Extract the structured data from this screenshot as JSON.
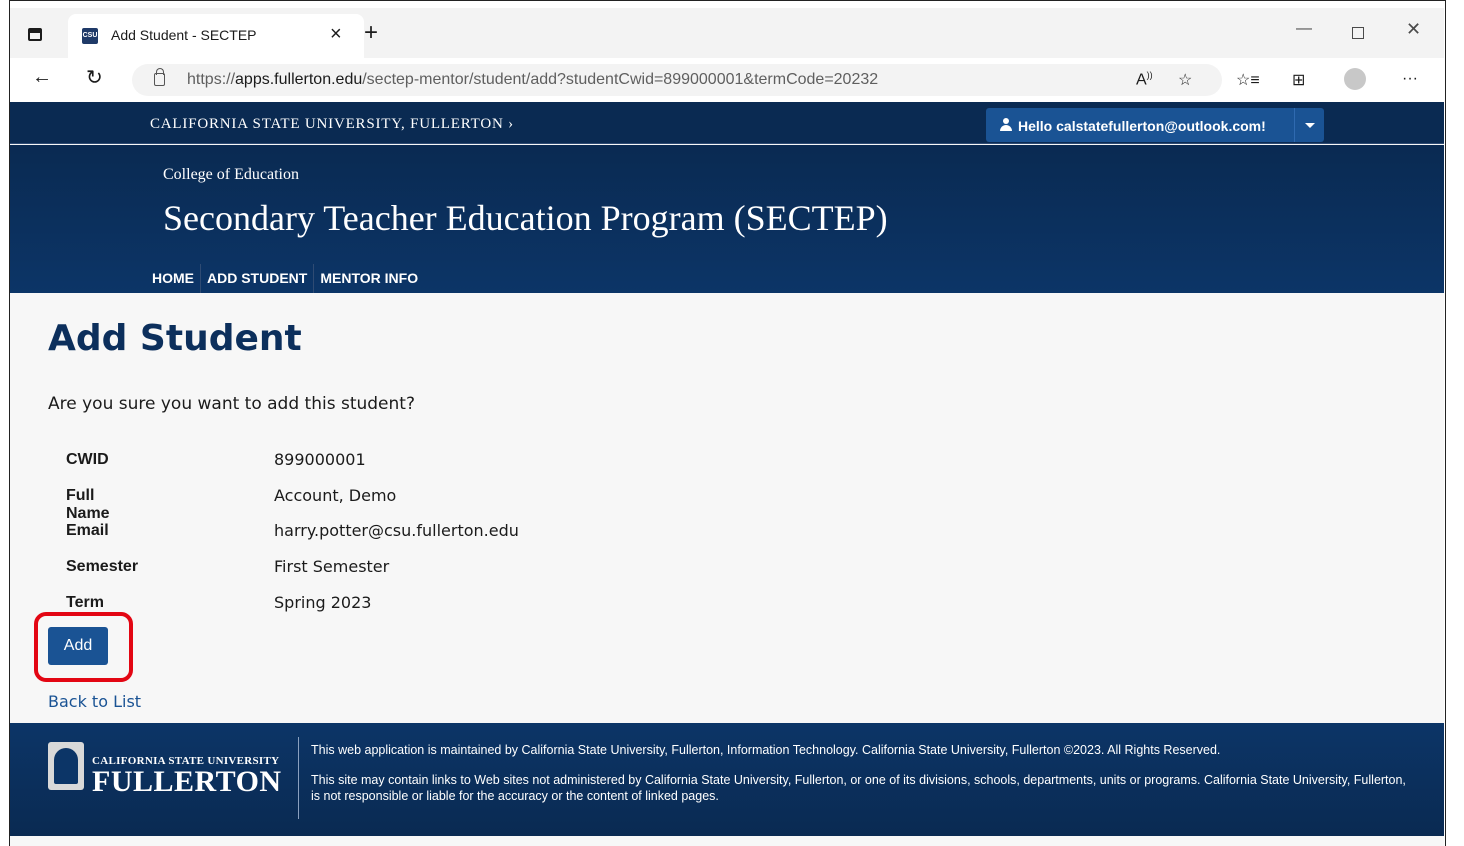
{
  "browser": {
    "tab_title": "Add Student - SECTEP",
    "tab_close": "×",
    "new_tab": "+",
    "url_prefix": "https://",
    "url_host": "apps.fullerton.edu",
    "url_path": "/sectep-mentor/student/add?studentCwid=899000001&termCode=20232",
    "window_min": "—",
    "window_close": "✕",
    "nav_back": "←",
    "nav_refresh": "↻"
  },
  "site": {
    "university_link": "CALIFORNIA STATE UNIVERSITY, FULLERTON ›",
    "user_greeting": "Hello calstatefullerton@outlook.com!",
    "college": "College of Education",
    "program": "Secondary Teacher Education Program (SECTEP)",
    "nav": [
      "HOME",
      "ADD STUDENT",
      "MENTOR INFO"
    ]
  },
  "main": {
    "title": "Add Student",
    "prompt": "Are you sure you want to add this student?",
    "details": [
      {
        "label": "CWID",
        "value": "899000001"
      },
      {
        "label": "Full Name",
        "value": "Account, Demo"
      },
      {
        "label": "Email",
        "value": "harry.potter@csu.fullerton.edu"
      },
      {
        "label": "Semester",
        "value": "First Semester"
      },
      {
        "label": "Term",
        "value": "Spring 2023"
      }
    ],
    "add_button": "Add",
    "back_link": "Back to List"
  },
  "footer": {
    "logo_line1": "CALIFORNIA STATE UNIVERSITY",
    "logo_line2": "FULLERTON",
    "text1": "This web application is maintained by California State University, Fullerton, Information Technology. California State University, Fullerton ©2023. All Rights Reserved.",
    "text2": "This site may contain links to Web sites not administered by California State University, Fullerton, or one of its divisions, schools, departments, units or programs. California State University, Fullerton, is not responsible or liable for the accuracy or the content of linked pages."
  },
  "colors": {
    "navy": "#0a2a52",
    "button_blue": "#1a5394",
    "highlight_red": "#e30613",
    "title_navy": "#0c2f5c"
  }
}
